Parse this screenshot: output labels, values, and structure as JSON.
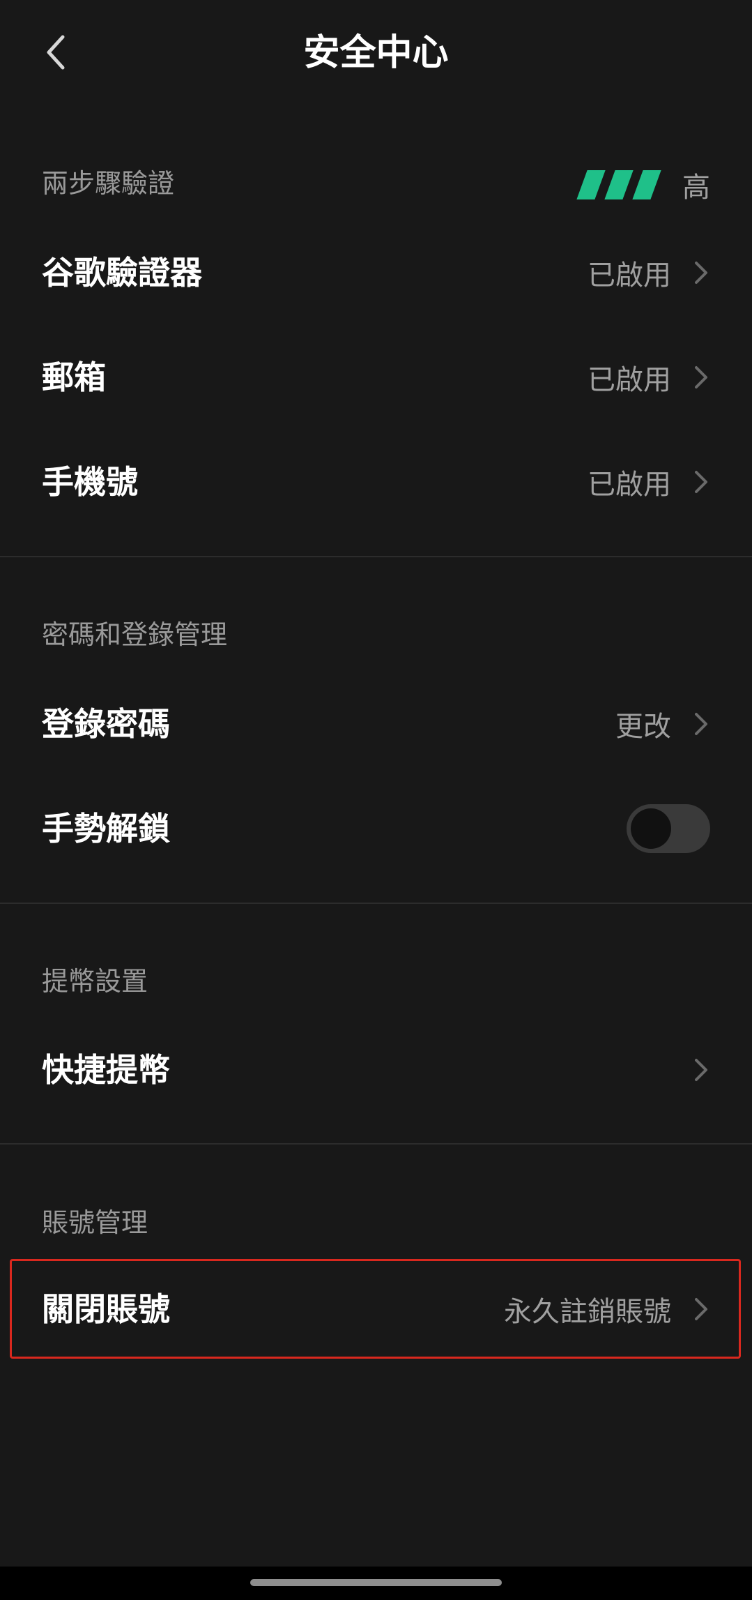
{
  "header": {
    "title": "安全中心"
  },
  "sections": {
    "two_step": {
      "label": "兩步驟驗證",
      "strength_label": "高",
      "items": [
        {
          "label": "谷歌驗證器",
          "value": "已啟用"
        },
        {
          "label": "郵箱",
          "value": "已啟用"
        },
        {
          "label": "手機號",
          "value": "已啟用"
        }
      ]
    },
    "password": {
      "label": "密碼和登錄管理",
      "items": [
        {
          "label": "登錄密碼",
          "value": "更改"
        },
        {
          "label": "手勢解鎖",
          "toggle": false
        }
      ]
    },
    "withdraw": {
      "label": "提幣設置",
      "items": [
        {
          "label": "快捷提幣",
          "value": ""
        }
      ]
    },
    "account": {
      "label": "賬號管理",
      "items": [
        {
          "label": "關閉賬號",
          "value": "永久註銷賬號"
        }
      ]
    }
  },
  "colors": {
    "background": "#181818",
    "accent_green": "#1fc089",
    "highlight_red": "#d9281e"
  }
}
